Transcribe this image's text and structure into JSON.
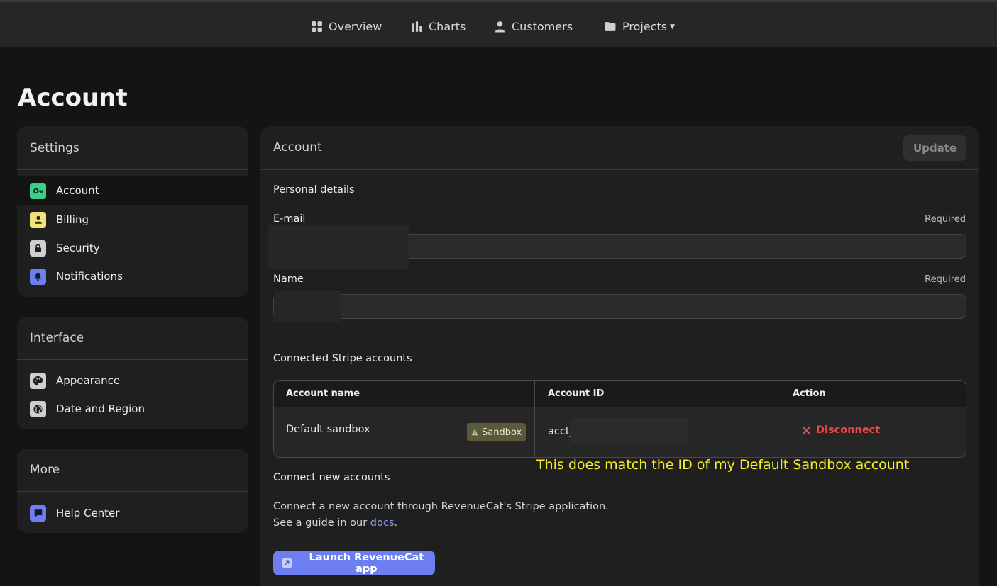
{
  "nav": {
    "items": [
      {
        "label": "Overview",
        "icon": "grid-icon"
      },
      {
        "label": "Charts",
        "icon": "bar-chart-icon"
      },
      {
        "label": "Customers",
        "icon": "user-icon"
      },
      {
        "label": "Projects",
        "icon": "folder-icon"
      }
    ]
  },
  "page": {
    "title": "Account"
  },
  "sidebar": {
    "settings": {
      "title": "Settings",
      "items": [
        {
          "label": "Account",
          "icon": "key-icon",
          "color": "#3ad08a"
        },
        {
          "label": "Billing",
          "icon": "person-icon",
          "color": "#f2e27a"
        },
        {
          "label": "Security",
          "icon": "lock-icon",
          "color": "#cfcfcf"
        },
        {
          "label": "Notifications",
          "icon": "bell-icon",
          "color": "#6c7ef0"
        }
      ]
    },
    "interface": {
      "title": "Interface",
      "items": [
        {
          "label": "Appearance",
          "icon": "palette-icon",
          "color": "#cfcfcf"
        },
        {
          "label": "Date and Region",
          "icon": "globe-icon",
          "color": "#cfcfcf"
        }
      ]
    },
    "more": {
      "title": "More",
      "items": [
        {
          "label": "Help Center",
          "icon": "chat-icon",
          "color": "#6c7ef0"
        }
      ]
    }
  },
  "main": {
    "title": "Account",
    "update_label": "Update",
    "personal_details": "Personal details",
    "email": {
      "label": "E-mail",
      "required": "Required",
      "value": ""
    },
    "name": {
      "label": "Name",
      "required": "Required",
      "value": ""
    },
    "stripe": {
      "title": "Connected Stripe accounts",
      "columns": [
        "Account name",
        "Account ID",
        "Action"
      ],
      "rows": [
        {
          "name": "Default sandbox",
          "badge": "Sandbox",
          "account_id": "acct_",
          "action": "Disconnect"
        }
      ]
    },
    "annotation": "This does match the ID of my Default Sandbox account",
    "connect": {
      "title": "Connect new accounts",
      "line1": "Connect a new account through RevenueCat's Stripe application.",
      "line2_prefix": "See a guide in our ",
      "line2_link": "docs",
      "line2_suffix": ".",
      "button_label": "Launch RevenueCat app"
    }
  },
  "colors": {
    "accent": "#6c7ef0",
    "danger": "#e5484d",
    "annotation": "#f4ef2a"
  }
}
